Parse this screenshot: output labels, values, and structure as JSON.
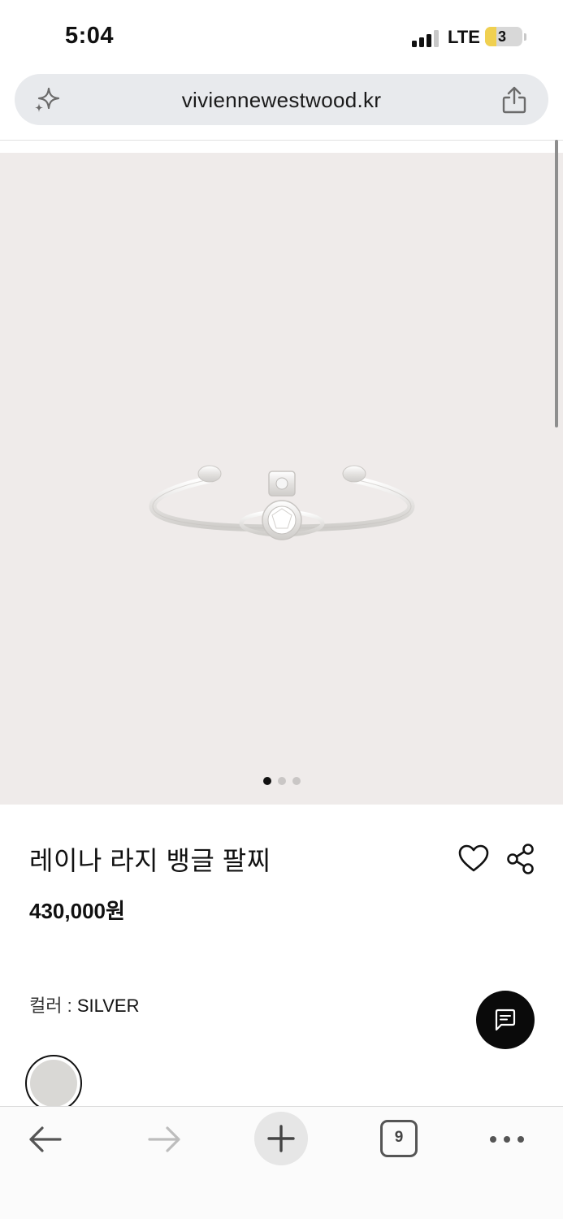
{
  "status_bar": {
    "time": "5:04",
    "network": "LTE",
    "battery_level": "3",
    "signal_bars_active": 3,
    "signal_bars_total": 4
  },
  "browser": {
    "url": "viviennewestwood.kr",
    "sparkle_icon": "sparkle-icon",
    "share_icon": "share-icon"
  },
  "gallery": {
    "image_description_icon": "bangle-image",
    "page_count": 3,
    "active_index": 0
  },
  "product": {
    "title": "레이나 라지 뱅글 팔찌",
    "price": "430,000원",
    "color_label": "컬러 : ",
    "color_value": "SILVER",
    "swatch_color": "#d9d8d5"
  },
  "toolbar": {
    "tab_count": "9"
  },
  "colors": {
    "image_background": "#efebea",
    "chat_button": "#0a0a0a",
    "text": "#111111"
  }
}
